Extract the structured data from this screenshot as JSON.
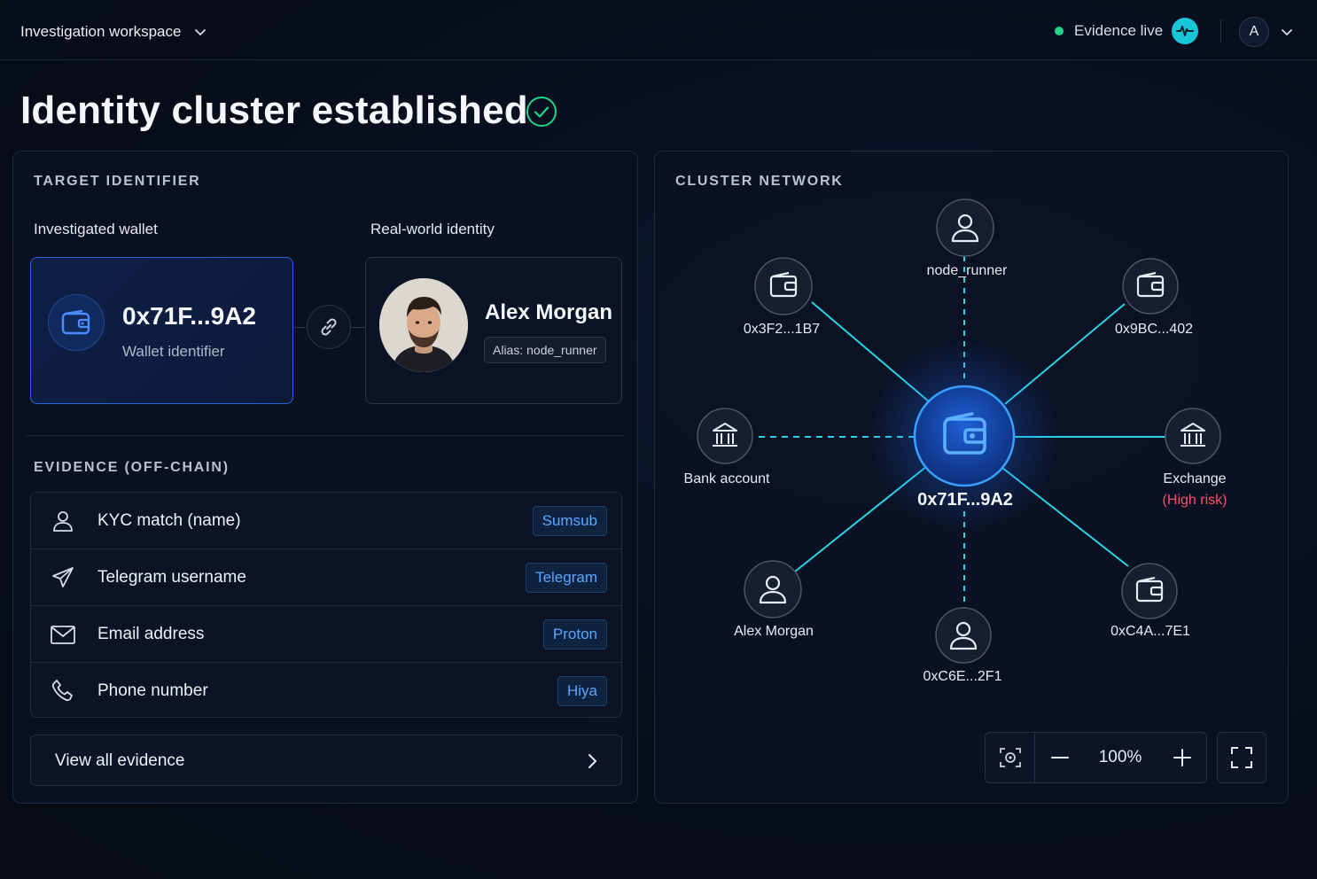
{
  "header": {
    "workspace_label": "Investigation workspace",
    "status_label": "Evidence live",
    "avatar_initial": "A"
  },
  "page": {
    "title": "Identity cluster established"
  },
  "target": {
    "section_label": "TARGET IDENTIFIER",
    "wallet_heading": "Investigated wallet",
    "identity_heading": "Real-world identity",
    "wallet_address": "0x71F...9A2",
    "wallet_sub": "Wallet identifier",
    "person_name": "Alex Morgan",
    "alias": "Alias: node_runner"
  },
  "evidence": {
    "section_label": "EVIDENCE (OFF-CHAIN)",
    "items": [
      {
        "label": "KYC match (name)",
        "source": "Sumsub",
        "icon": "user-icon"
      },
      {
        "label": "Telegram username",
        "source": "Telegram",
        "icon": "send-icon"
      },
      {
        "label": "Email address",
        "source": "Proton",
        "icon": "mail-icon"
      },
      {
        "label": "Phone number",
        "source": "Hiya",
        "icon": "phone-icon"
      }
    ],
    "view_all_label": "View all evidence"
  },
  "network": {
    "section_label": "CLUSTER NETWORK",
    "center_label": "0x71F...9A2",
    "nodes": [
      {
        "label": "node_runner",
        "type": "person",
        "link": "dashed"
      },
      {
        "label": "0x3F2...1B7",
        "type": "wallet",
        "link": "solid"
      },
      {
        "label": "0x9BC...402",
        "type": "wallet",
        "link": "solid"
      },
      {
        "label": "Bank account",
        "type": "bank",
        "link": "dashed"
      },
      {
        "label": "Exchange",
        "sublabel": "(High risk)",
        "type": "bank",
        "link": "solid"
      },
      {
        "label": "Alex Morgan",
        "type": "person",
        "link": "solid"
      },
      {
        "label": "0xC6E...2F1",
        "type": "person",
        "link": "dashed"
      },
      {
        "label": "0xC4A...7E1",
        "type": "wallet",
        "link": "solid"
      }
    ],
    "zoom_level": "100%"
  },
  "colors": {
    "accent": "#19c6d9",
    "primary": "#2a64d8",
    "live": "#22d38a",
    "risk": "#ff4d6a",
    "badge_text": "#5aa6ff"
  }
}
